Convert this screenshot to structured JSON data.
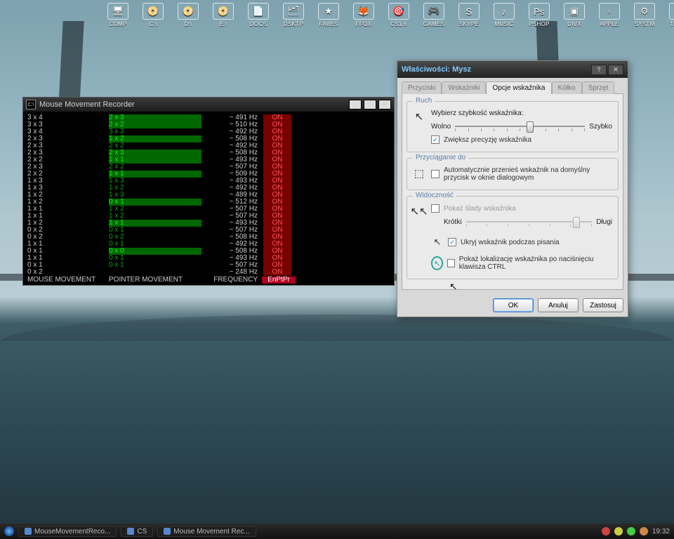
{
  "desktop_icons": [
    "COMP",
    "C:\\",
    "D:\\",
    "E:\\",
    "DOCS",
    "DSKTP",
    "FAVES",
    "FFOX",
    "CS1.6",
    "GAMES",
    "SKYPE",
    "MUSIC",
    "PSHOP",
    "DIVX",
    "APPLE",
    "SYSTM",
    "TRASH"
  ],
  "console": {
    "title": "Mouse Movement Recorder",
    "rows": [
      {
        "m": "3 x 4",
        "p": "2 x 3",
        "f": "~ 491 Hz",
        "s": "ON",
        "hl": true
      },
      {
        "m": "3 x 3",
        "p": "2 x 2",
        "f": "~ 510 Hz",
        "s": "ON",
        "hl": true
      },
      {
        "m": "3 x 4",
        "p": "3 x 3",
        "f": "~ 492 Hz",
        "s": "ON",
        "hl": false
      },
      {
        "m": "2 x 3",
        "p": "1 x 2",
        "f": "~ 508 Hz",
        "s": "ON",
        "hl": true
      },
      {
        "m": "2 x 3",
        "p": "2 x 2",
        "f": "~ 492 Hz",
        "s": "ON",
        "hl": false
      },
      {
        "m": "2 x 3",
        "p": "2 x 3",
        "f": "~ 508 Hz",
        "s": "ON",
        "hl": true
      },
      {
        "m": "2 x 2",
        "p": "1 x 1",
        "f": "~ 493 Hz",
        "s": "ON",
        "hl": true
      },
      {
        "m": "2 x 3",
        "p": "2 x 2",
        "f": "~ 507 Hz",
        "s": "ON",
        "hl": false
      },
      {
        "m": "2 x 2",
        "p": "1 x 1",
        "f": "~ 509 Hz",
        "s": "ON",
        "hl": true
      },
      {
        "m": "1 x 3",
        "p": "1 x 3",
        "f": "~ 493 Hz",
        "s": "ON",
        "hl": false
      },
      {
        "m": "1 x 3",
        "p": "1 x 2",
        "f": "~ 492 Hz",
        "s": "ON",
        "hl": false
      },
      {
        "m": "1 x 2",
        "p": "1 x 3",
        "f": "~ 489 Hz",
        "s": "ON",
        "hl": false
      },
      {
        "m": "1 x 2",
        "p": "0 x 1",
        "f": "~ 512 Hz",
        "s": "ON",
        "hl": true
      },
      {
        "m": "1 x 1",
        "p": "1 x 2",
        "f": "~ 507 Hz",
        "s": "ON",
        "hl": false
      },
      {
        "m": "1 x 1",
        "p": "1 x 2",
        "f": "~ 507 Hz",
        "s": "ON",
        "hl": false
      },
      {
        "m": "1 x 2",
        "p": "1 x 1",
        "f": "~ 493 Hz",
        "s": "ON",
        "hl": true
      },
      {
        "m": "0 x 2",
        "p": "0 x 1",
        "f": "~ 507 Hz",
        "s": "ON",
        "hl": false
      },
      {
        "m": "0 x 2",
        "p": "0 x 2",
        "f": "~ 508 Hz",
        "s": "ON",
        "hl": false
      },
      {
        "m": "1 x 1",
        "p": "0 x 1",
        "f": "~ 492 Hz",
        "s": "ON",
        "hl": false
      },
      {
        "m": "0 x 1",
        "p": "0 x 0",
        "f": "~ 508 Hz",
        "s": "ON",
        "hl": true
      },
      {
        "m": "1 x 1",
        "p": "0 x 1",
        "f": "~ 493 Hz",
        "s": "ON",
        "hl": false
      },
      {
        "m": "0 x 1",
        "p": "0 x 1",
        "f": "~ 507 Hz",
        "s": "ON",
        "hl": false
      },
      {
        "m": "0 x 2",
        "p": "",
        "f": "~ 248 Hz",
        "s": "ON",
        "hl": false
      }
    ],
    "footer": {
      "c1": "MOUSE MOVEMENT",
      "c2": "POINTER MOVEMENT",
      "c3": "FREQUENCY",
      "c4": "EnPtPr"
    }
  },
  "dialog": {
    "title": "Właściwości: Mysz",
    "tabs": [
      "Przyciski",
      "Wskaźniki",
      "Opcje wskaźnika",
      "Kółko",
      "Sprzęt"
    ],
    "active_tab": 2,
    "ruch": {
      "legend": "Ruch",
      "label": "Wybierz szybkość wskaźnika:",
      "slow": "Wolno",
      "fast": "Szybko",
      "precision": "Zwiększ precyzję wskaźnika",
      "precision_checked": true,
      "slider_pos": 0.55
    },
    "snap": {
      "legend": "Przyciąganie do",
      "label": "Automatycznie przenieś wskaźnik na domyślny przycisk w oknie dialogowym",
      "checked": false
    },
    "vis": {
      "legend": "Widoczność",
      "trails": "Pokaż ślady wskaźnika",
      "trails_checked": false,
      "trail_short": "Krótki",
      "trail_long": "Długi",
      "hide": "Ukryj wskaźnik podczas pisania",
      "hide_checked": true,
      "ctrl": "Pokaż lokalizację wskaźnika po naciśnięciu klawisza CTRL",
      "ctrl_checked": false
    },
    "buttons": {
      "ok": "OK",
      "cancel": "Anuluj",
      "apply": "Zastosuj"
    }
  },
  "taskbar": {
    "items": [
      "MouseMovementReco...",
      "CS",
      "Mouse Movement Rec..."
    ],
    "clock": "19:32"
  }
}
